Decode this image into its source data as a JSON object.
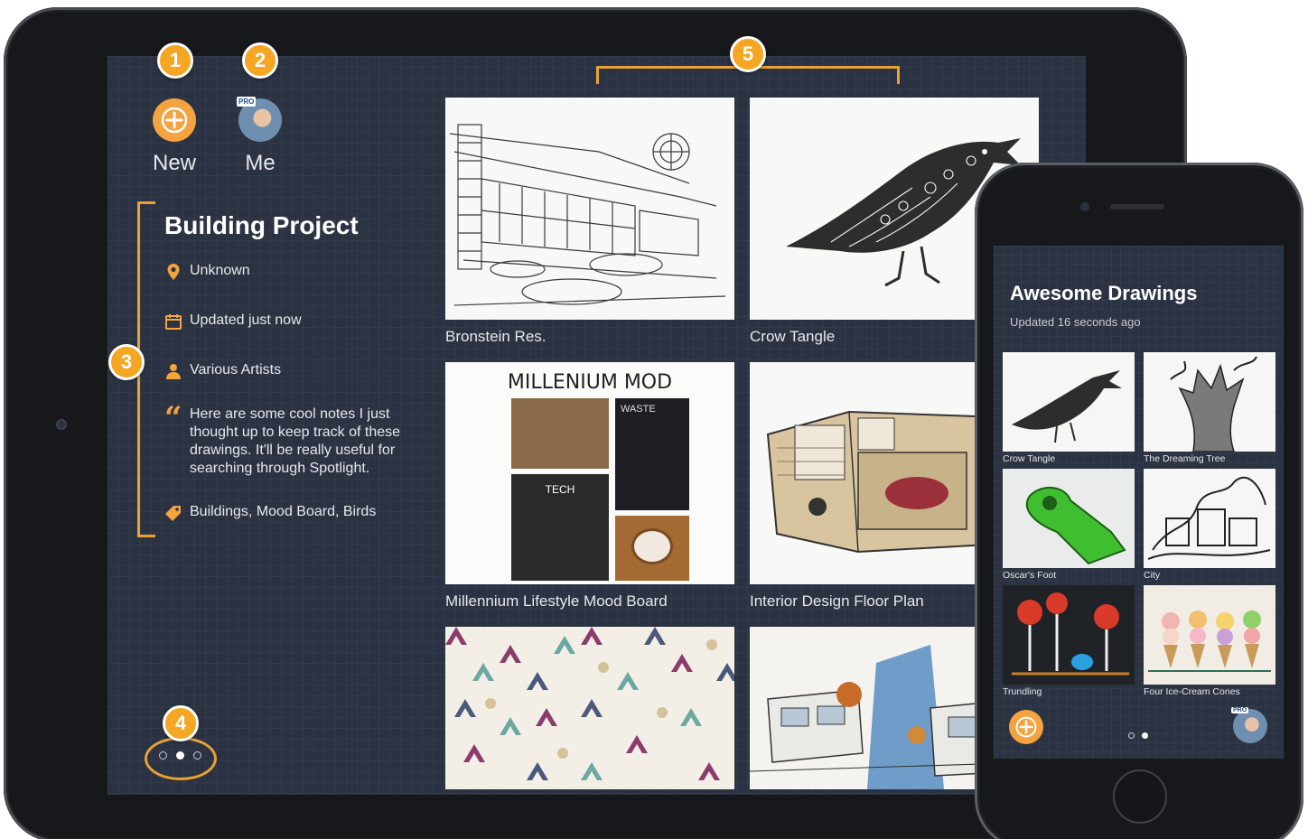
{
  "callouts": [
    "1",
    "2",
    "5",
    "3",
    "4"
  ],
  "ipad": {
    "top_actions": {
      "new_label": "New",
      "me_label": "Me",
      "pro_badge": "PRO"
    },
    "project": {
      "title": "Building Project",
      "location": "Unknown",
      "updated": "Updated just now",
      "author": "Various Artists",
      "notes": "Here are some cool notes I just thought up to keep track of these drawings. It'll be really useful for searching through Spotlight.",
      "tags": "Buildings, Mood Board, Birds"
    },
    "drawings": [
      {
        "title": "Bronstein Res."
      },
      {
        "title": "Crow Tangle"
      },
      {
        "title": "Millennium Lifestyle Mood Board",
        "thumb_heading": "MILLENIUM MOD",
        "thumb_tags": [
          "WASTE",
          "TECH"
        ]
      },
      {
        "title": "Interior Design Floor Plan"
      },
      {
        "title": ""
      },
      {
        "title": ""
      }
    ],
    "page_indicator": {
      "count": 3,
      "active": 2
    }
  },
  "iphone": {
    "title": "Awesome Drawings",
    "subtitle": "Updated 16 seconds ago",
    "pro_badge": "PRO",
    "drawings": [
      {
        "title": "Crow Tangle"
      },
      {
        "title": "The Dreaming Tree"
      },
      {
        "title": "Oscar's Foot"
      },
      {
        "title": "City"
      },
      {
        "title": "Trundling"
      },
      {
        "title": "Four Ice-Cream Cones"
      }
    ],
    "page_indicator": {
      "count": 2,
      "active": 2
    }
  },
  "colors": {
    "accent": "#f5a340",
    "callout": "#f5a623",
    "screen_bg": "#2b3343",
    "device_frame": "#16181c",
    "text": "#e6e8ec"
  },
  "icons": [
    "plus-icon",
    "location-pin-icon",
    "calendar-icon",
    "person-icon",
    "quote-icon",
    "tag-icon"
  ]
}
